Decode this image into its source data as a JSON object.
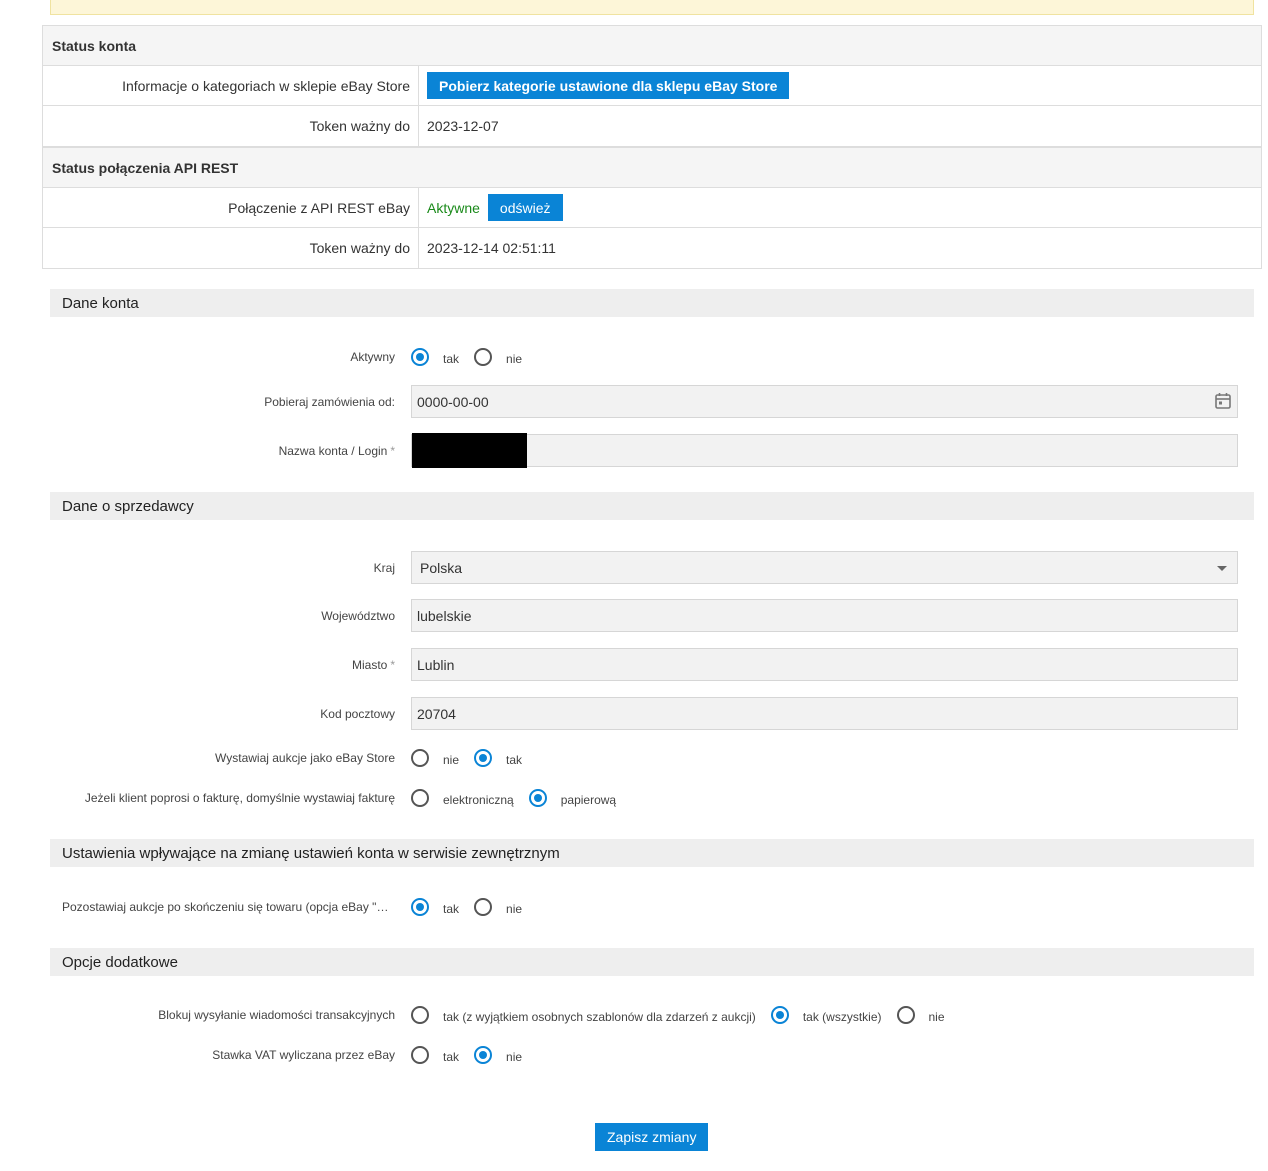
{
  "status_konta": {
    "heading": "Status konta",
    "rows": [
      {
        "label": "Informacje o kategoriach w sklepie eBay Store",
        "button": "Pobierz kategorie ustawione dla sklepu eBay Store"
      },
      {
        "label": "Token ważny do",
        "value": "2023-12-07"
      }
    ]
  },
  "status_api": {
    "heading": "Status połączenia API REST",
    "rows": [
      {
        "label": "Połączenie z API REST eBay",
        "status": "Aktywne",
        "button": "odśwież"
      },
      {
        "label": "Token ważny do",
        "value": "2023-12-14 02:51:11"
      }
    ]
  },
  "dane_konta": {
    "heading": "Dane konta",
    "aktywny": {
      "label": "Aktywny",
      "options": [
        "tak",
        "nie"
      ],
      "selected": "tak"
    },
    "pobieraj": {
      "label": "Pobieraj zamówienia od:",
      "value": "0000-00-00"
    },
    "nazwa": {
      "label": "Nazwa konta / Login",
      "required": "*"
    }
  },
  "dane_sprzedawcy": {
    "heading": "Dane o sprzedawcy",
    "kraj": {
      "label": "Kraj",
      "value": "Polska"
    },
    "wojewodztwo": {
      "label": "Województwo",
      "value": "lubelskie"
    },
    "miasto": {
      "label": "Miasto",
      "required": "*",
      "value": "Lublin"
    },
    "kod": {
      "label": "Kod pocztowy",
      "value": "20704"
    },
    "ebay_store": {
      "label": "Wystawiaj aukcje jako eBay Store",
      "options": [
        "nie",
        "tak"
      ],
      "selected": "tak"
    },
    "faktura": {
      "label": "Jeżeli klient poprosi o fakturę, domyślnie wystawiaj fakturę",
      "options": [
        "elektroniczną",
        "papierową"
      ],
      "selected": "papierową"
    }
  },
  "ustawienia": {
    "heading": "Ustawienia wpływające na zmianę ustawień konta w serwisie zewnętrznym",
    "pozostawiaj": {
      "label": "Pozostawiaj aukcje po skończeniu się towaru (opcja eBay \"Brak …",
      "options": [
        "tak",
        "nie"
      ],
      "selected": "tak"
    }
  },
  "opcje": {
    "heading": "Opcje dodatkowe",
    "blokuj": {
      "label": "Blokuj wysyłanie wiadomości transakcyjnych",
      "options": [
        "tak (z wyjątkiem osobnych szablonów dla zdarzeń z aukcji)",
        "tak (wszystkie)",
        "nie"
      ],
      "selected": "tak (wszystkie)"
    },
    "vat": {
      "label": "Stawka VAT wyliczana przez eBay",
      "options": [
        "tak",
        "nie"
      ],
      "selected": "nie"
    }
  },
  "save_label": "Zapisz zmiany",
  "colors": {
    "accent": "#0a84d6",
    "active": "#1a8a1a",
    "warning_bg": "#fdf6d8"
  }
}
